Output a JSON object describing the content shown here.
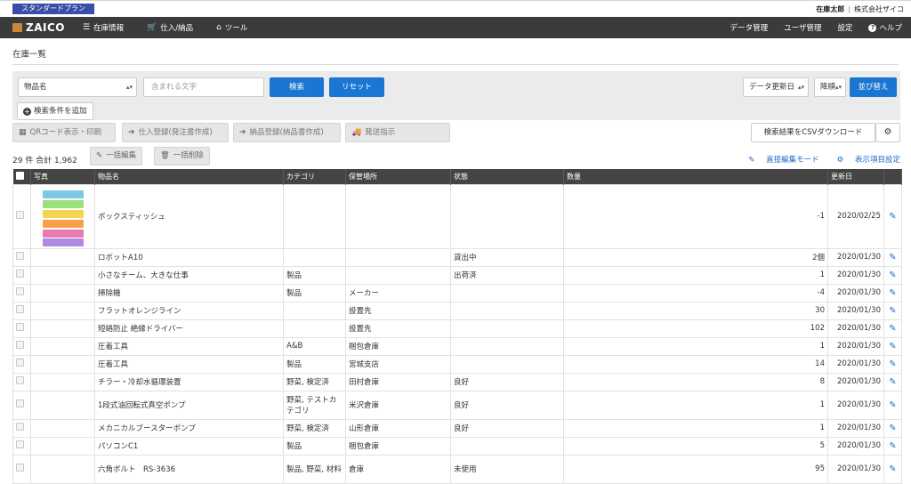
{
  "plan_badge": "スタンダードプラン",
  "user": {
    "name": "在庫太郎",
    "separator": "|",
    "company": "株式会社ザイコ"
  },
  "nav": {
    "logo": "ZAICO",
    "left": [
      {
        "label": "在庫情報",
        "icon": "list-icon"
      },
      {
        "label": "仕入/納品",
        "icon": "cart-icon"
      },
      {
        "label": "ツール",
        "icon": "toolbox-icon"
      }
    ],
    "right": [
      "データ管理",
      "ユーザ管理",
      "設定",
      "ヘルプ"
    ]
  },
  "page_title": "在庫一覧",
  "search": {
    "field_select": "物品名",
    "text_placeholder": "含まれる文字",
    "search_button": "検索",
    "reset_button": "リセット",
    "sort_field": "データ更新日",
    "sort_order": "降順",
    "sort_button": "並び替え",
    "add_condition": "検索条件を追加"
  },
  "actions": {
    "qr": "QRコード表示・印刷",
    "purchase": "仕入登録(発注書作成)",
    "delivery": "納品登録(納品書作成)",
    "shipping": "発送指示",
    "csv": "検索結果をCSVダウンロード"
  },
  "summary": {
    "count": "29 件 合計 1,962"
  },
  "bulk": {
    "edit": "一括編集",
    "delete": "一括削除"
  },
  "links": {
    "direct_edit": "直接編集モード",
    "columns": "表示項目設定"
  },
  "table": {
    "headers": [
      "写真",
      "物品名",
      "カテゴリ",
      "保管場所",
      "状態",
      "数量",
      "更新日"
    ],
    "rows": [
      {
        "name": "ボックスティッシュ",
        "category": "",
        "location": "",
        "status": "",
        "qty": "-1",
        "date": "2020/02/25",
        "photo": true
      },
      {
        "name": "ロボットA10",
        "category": "",
        "location": "",
        "status": "貸出中",
        "qty": "2個",
        "date": "2020/01/30"
      },
      {
        "name": "小さなチーム、大きな仕事",
        "category": "製品",
        "location": "",
        "status": "出荷済",
        "qty": "1",
        "date": "2020/01/30"
      },
      {
        "name": "掃除機",
        "category": "製品",
        "location": "メーカー",
        "status": "",
        "qty": "-4",
        "date": "2020/01/30"
      },
      {
        "name": "フラットオレンジライン",
        "category": "",
        "location": "設置先",
        "status": "",
        "qty": "30",
        "date": "2020/01/30"
      },
      {
        "name": "短絡防止 絶縁ドライバー",
        "category": "",
        "location": "設置先",
        "status": "",
        "qty": "102",
        "date": "2020/01/30"
      },
      {
        "name": "圧着工具",
        "category": "A&B",
        "location": "梱包倉庫",
        "status": "",
        "qty": "1",
        "date": "2020/01/30"
      },
      {
        "name": "圧着工具",
        "category": "製品",
        "location": "宮城支店",
        "status": "",
        "qty": "14",
        "date": "2020/01/30"
      },
      {
        "name": "チラー・冷却水循環装置",
        "category": "野菜, 検定済",
        "location": "田村倉庫",
        "status": "良好",
        "qty": "8",
        "date": "2020/01/30"
      },
      {
        "name": "1段式油回転式真空ポンプ",
        "category": "野菜, テストカテゴリ",
        "location": "米沢倉庫",
        "status": "良好",
        "qty": "1",
        "date": "2020/01/30",
        "tall": true
      },
      {
        "name": "メカニカルブースターポンプ",
        "category": "野菜, 検定済",
        "location": "山形倉庫",
        "status": "良好",
        "qty": "1",
        "date": "2020/01/30"
      },
      {
        "name": "パソコンC1",
        "category": "製品",
        "location": "梱包倉庫",
        "status": "",
        "qty": "5",
        "date": "2020/01/30"
      },
      {
        "name": "六角ボルト　RS-3636",
        "category": "製品, 野菜, 材料",
        "location": "倉庫",
        "status": "未使用",
        "qty": "95",
        "date": "2020/01/30",
        "tall": true
      }
    ]
  },
  "colors": {
    "nav_bg": "#3b3b3b",
    "plan_badge": "#3a4da8",
    "primary": "#1976d2",
    "link": "#1a6cc7",
    "header_bg": "#444444"
  }
}
